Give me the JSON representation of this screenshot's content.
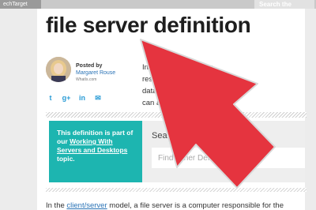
{
  "topbar": {
    "site_label": "echTarget",
    "search_label": "Search the"
  },
  "title": "file server definition",
  "author": {
    "posted_by": "Posted by",
    "name": "Margaret Rouse",
    "site": "WhatIs.com"
  },
  "social": [
    "twitter-icon",
    "google-plus-icon",
    "linkedin-icon",
    "email-icon"
  ],
  "body": {
    "line1": "In                                   , a file server is a c",
    "line2": "resp                                    age and mana",
    "line3": "data                                  omputers on the sam",
    "line4": "can acce"
  },
  "definition_box": {
    "prefix": "This definition is part of our",
    "link": "Working With Servers and Desktops",
    "suffix": "topic."
  },
  "search": {
    "label": "Search for another definition:",
    "placeholder": "Find Other Definitions"
  },
  "bottom": {
    "prefix": "In the ",
    "link": "client/server",
    "suffix": " model, a file server is a computer responsible for the"
  },
  "colors": {
    "teal": "#1db5b0",
    "arrow": "#e5343f",
    "link": "#2a73b6"
  }
}
